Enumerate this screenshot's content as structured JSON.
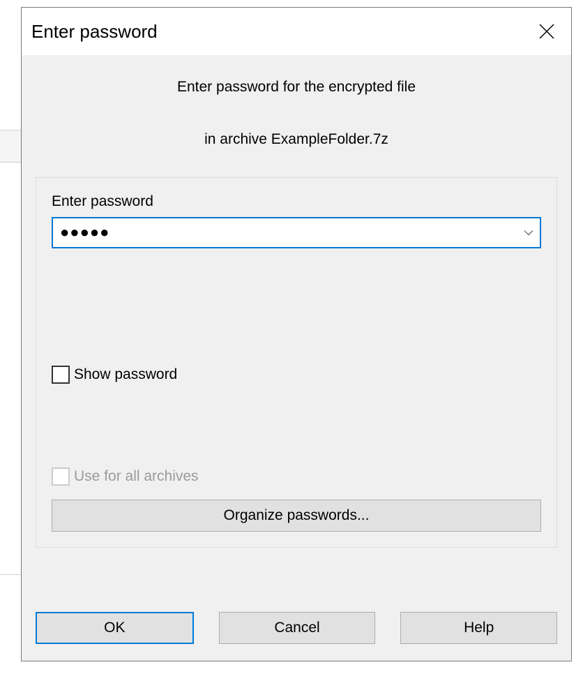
{
  "dialog": {
    "title": "Enter password",
    "prompt_line1": "Enter password for the encrypted file",
    "prompt_line2": "in archive ExampleFolder.7z",
    "field_label": "Enter password",
    "password_value": "●●●●●",
    "show_password_label": "Show password",
    "use_for_all_label": "Use for all archives",
    "organize_button": "Organize passwords...",
    "ok_button": "OK",
    "cancel_button": "Cancel",
    "help_button": "Help"
  }
}
